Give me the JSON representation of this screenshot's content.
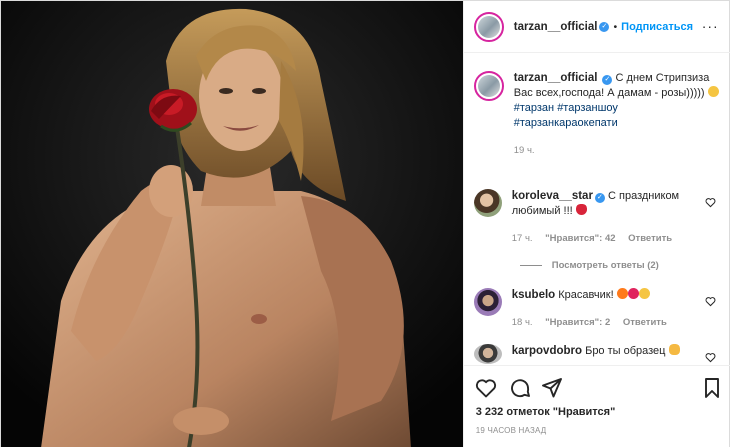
{
  "header": {
    "username": "tarzan__official",
    "verified_mark": "✓",
    "separator": "•",
    "follow_label": "Подписаться",
    "more_label": "···"
  },
  "caption": {
    "username": "tarzan__official",
    "text": "С днем Стрипзиза Вас всех,господа! А дамам - розы)))))",
    "hashtags": [
      "#тарзан",
      "#тарзаншоу",
      "#тарзанкараокепати"
    ],
    "time": "19 ч."
  },
  "comments": [
    {
      "username": "koroleva__star",
      "verified": true,
      "text": "С праздником любимый !!!",
      "emoji": "lips-emoji",
      "time": "17 ч.",
      "likes": "\"Нравится\": 42",
      "reply_label": "Ответить",
      "view_replies": "Посмотреть ответы (2)"
    },
    {
      "username": "ksubelo",
      "verified": false,
      "text": "Красавчик!",
      "emoji": "fire-heart-smile-emoji",
      "time": "18 ч.",
      "likes": "\"Нравится\": 2",
      "reply_label": "Ответить"
    },
    {
      "username": "karpovdobro",
      "verified": false,
      "text": "Бро ты образец",
      "emoji": "clap-emoji"
    }
  ],
  "actions": {
    "icons": [
      "heart-icon",
      "comment-icon",
      "share-icon",
      "bookmark-icon"
    ],
    "likes": "3 232 отметок \"Нравится\"",
    "posted": "19 ЧАСОВ НАЗАД"
  },
  "colors": {
    "accent": "#0095f6",
    "verified": "#3897f0",
    "muted": "#8e8e8e",
    "hashtag": "#00376b"
  }
}
